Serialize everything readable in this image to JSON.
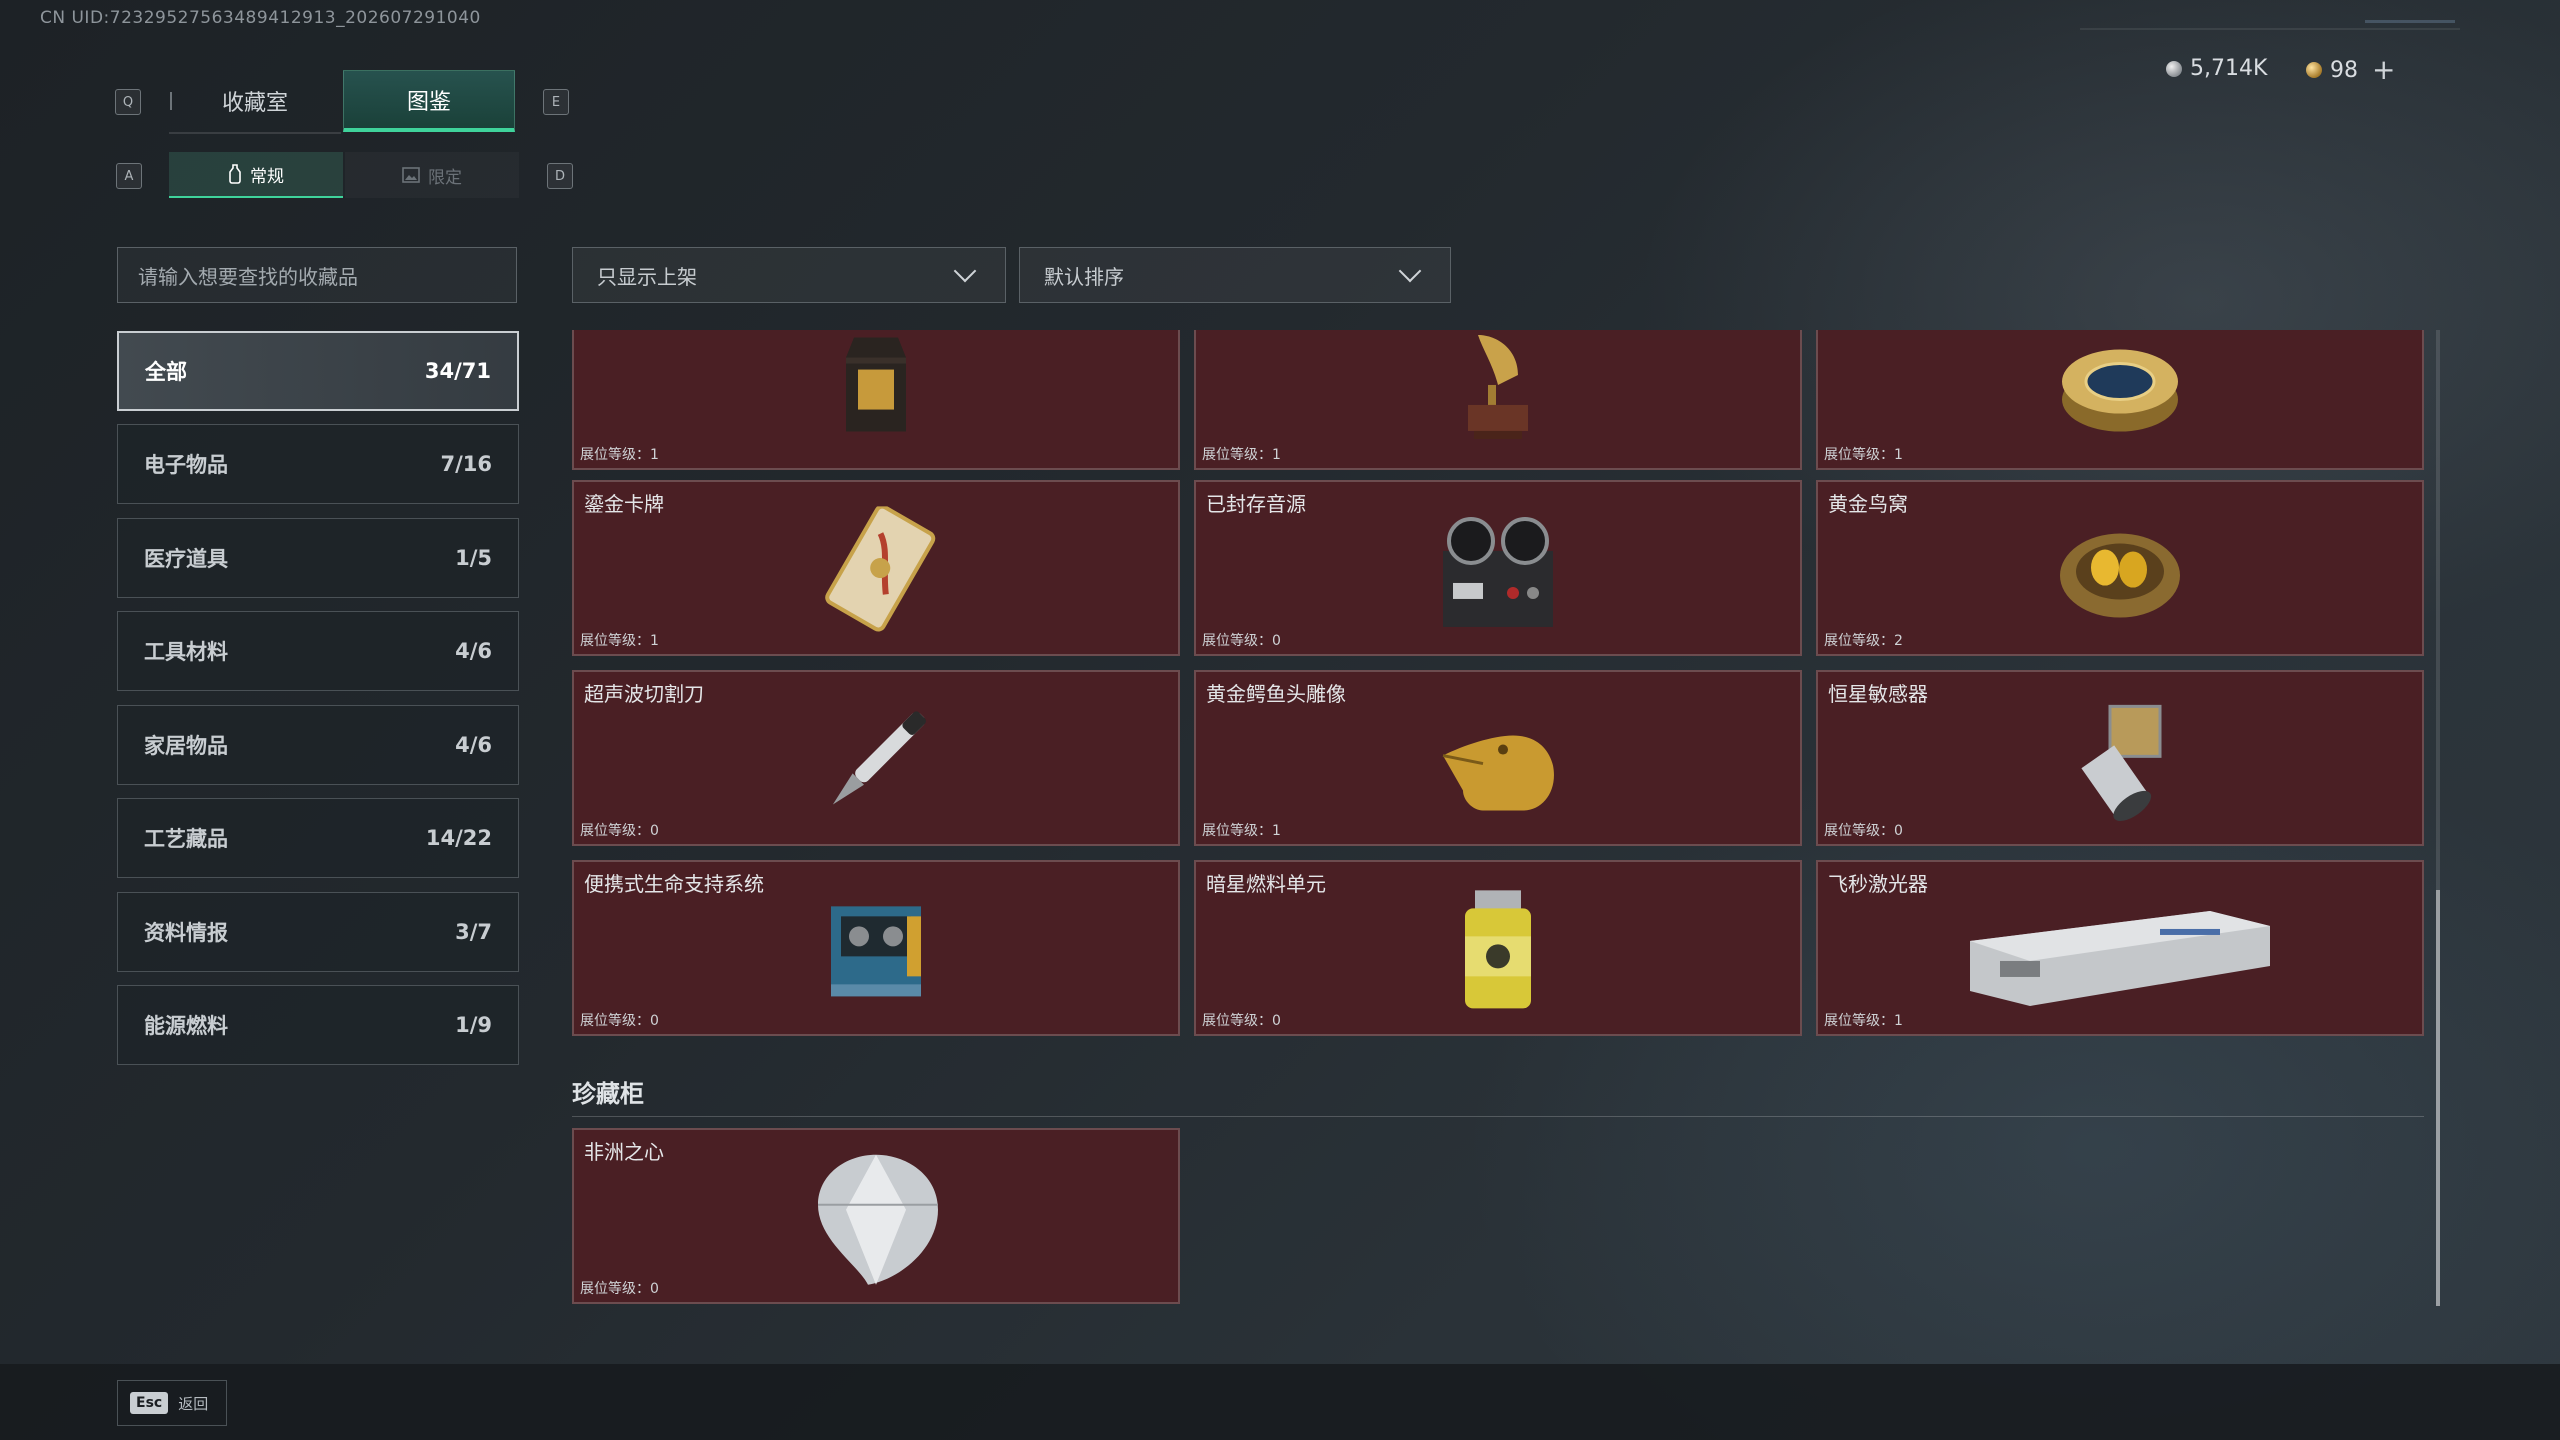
{
  "uid": "CN UID:72329527563489412913_202607291040",
  "currency": {
    "silver": "5,714K",
    "gold": "98"
  },
  "keys": {
    "prev_tab": "Q",
    "next_tab": "E",
    "prev_sub": "A",
    "next_sub": "D"
  },
  "tabs": [
    {
      "label": "收藏室",
      "active": false
    },
    {
      "label": "图鉴",
      "active": true
    }
  ],
  "subtabs": [
    {
      "label": "常规",
      "active": true
    },
    {
      "label": "限定",
      "active": false
    }
  ],
  "search": {
    "placeholder": "请输入想要查找的收藏品"
  },
  "filters": {
    "shelf": "只显示上架",
    "sort": "默认排序"
  },
  "categories": [
    {
      "label": "全部",
      "count": "34/71",
      "active": true
    },
    {
      "label": "电子物品",
      "count": "7/16"
    },
    {
      "label": "医疗道具",
      "count": "1/5"
    },
    {
      "label": "工具材料",
      "count": "4/6"
    },
    {
      "label": "家居物品",
      "count": "4/6"
    },
    {
      "label": "工艺藏品",
      "count": "14/22"
    },
    {
      "label": "资料情报",
      "count": "3/7"
    },
    {
      "label": "能源燃料",
      "count": "1/9"
    }
  ],
  "level_prefix": "展位等级：",
  "items": [
    {
      "name": "",
      "level": "1",
      "icon": "coffee-bag-icon"
    },
    {
      "name": "",
      "level": "1",
      "icon": "gramophone-icon"
    },
    {
      "name": "",
      "level": "1",
      "icon": "caviar-tin-icon"
    },
    {
      "name": "鎏金卡牌",
      "level": "1",
      "icon": "gilded-card-icon"
    },
    {
      "name": "已封存音源",
      "level": "0",
      "icon": "tape-recorder-icon"
    },
    {
      "name": "黄金鸟窝",
      "level": "2",
      "icon": "golden-nest-icon"
    },
    {
      "name": "超声波切割刀",
      "level": "0",
      "icon": "ultrasonic-knife-icon"
    },
    {
      "name": "黄金鳄鱼头雕像",
      "level": "1",
      "icon": "golden-crocodile-icon"
    },
    {
      "name": "恒星敏感器",
      "level": "0",
      "icon": "star-sensor-icon"
    },
    {
      "name": "便携式生命支持系统",
      "level": "0",
      "icon": "life-support-icon"
    },
    {
      "name": "暗星燃料单元",
      "level": "0",
      "icon": "fuel-cell-icon"
    },
    {
      "name": "飞秒激光器",
      "level": "1",
      "icon": "femtosecond-laser-icon"
    }
  ],
  "section": {
    "title": "珍藏柜"
  },
  "treasure_items": [
    {
      "name": "非洲之心",
      "level": "0",
      "icon": "diamond-icon"
    }
  ],
  "footer": {
    "esc_key": "Esc",
    "back_label": "返回"
  }
}
